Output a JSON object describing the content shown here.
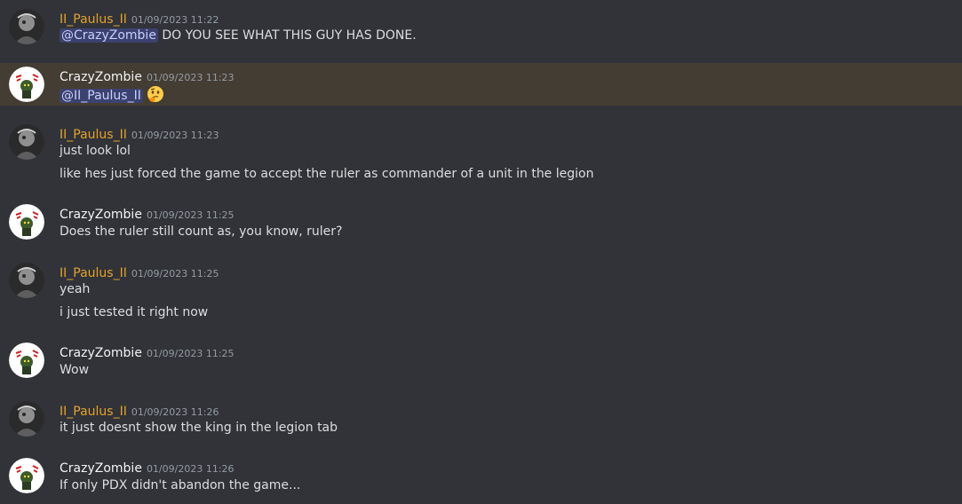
{
  "colors": {
    "background": "#313338",
    "highlight": "#443d33",
    "paulus_name": "#e0a32f",
    "zombie_name": "#f2f3f5",
    "text": "#dbdee1",
    "timestamp": "#949ba4",
    "mention_bg": "#3c4270",
    "mention_fg": "#c9cdfb"
  },
  "messages": [
    {
      "author": "II_Paulus_II",
      "time": "01/09/2023 11:22",
      "mention": "@CrazyZombie",
      "text": " DO YOU SEE WHAT THIS GUY HAS DONE."
    },
    {
      "author": "CrazyZombie",
      "time": "01/09/2023 11:23",
      "mention": "@II_Paulus_II",
      "emoji": "thinking-face-emoji"
    },
    {
      "author": "II_Paulus_II",
      "time": "01/09/2023 11:23",
      "lines": [
        "just look lol",
        "like hes just forced the game to accept the ruler as commander of a unit in the legion"
      ]
    },
    {
      "author": "CrazyZombie",
      "time": "01/09/2023 11:25",
      "lines": [
        "Does the ruler still count as, you know, ruler?"
      ]
    },
    {
      "author": "II_Paulus_II",
      "time": "01/09/2023 11:25",
      "lines": [
        "yeah",
        "i just tested it right now"
      ]
    },
    {
      "author": "CrazyZombie",
      "time": "01/09/2023 11:25",
      "lines": [
        "Wow"
      ]
    },
    {
      "author": "II_Paulus_II",
      "time": "01/09/2023 11:26",
      "lines": [
        "it just doesnt show the king in the legion tab"
      ]
    },
    {
      "author": "CrazyZombie",
      "time": "01/09/2023 11:26",
      "lines": [
        "If only PDX didn't abandon the game..."
      ]
    }
  ]
}
